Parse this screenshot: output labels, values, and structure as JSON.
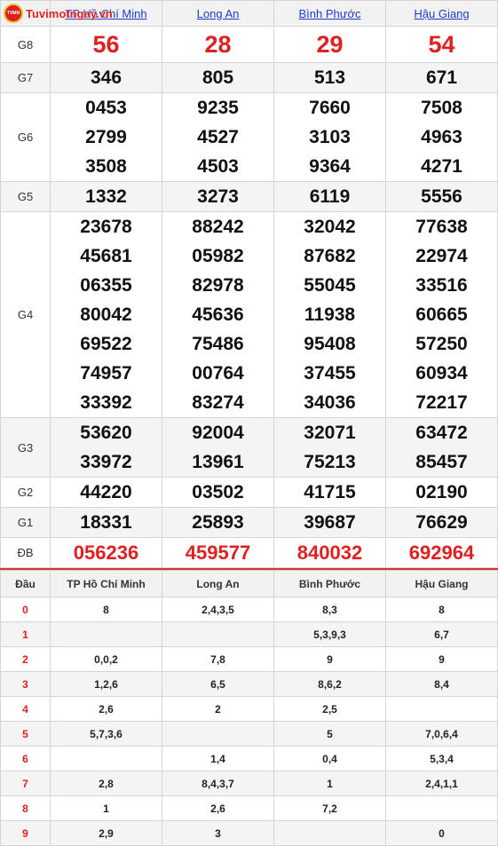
{
  "logo_text": "Tuvimotngay.vn",
  "provinces": [
    "TP Hồ Chí Minh",
    "Long An",
    "Bình Phước",
    "Hậu Giang"
  ],
  "prizes": [
    {
      "label": "G8",
      "values": [
        [
          "56"
        ],
        [
          "28"
        ],
        [
          "29"
        ],
        [
          "54"
        ]
      ]
    },
    {
      "label": "G7",
      "values": [
        [
          "346"
        ],
        [
          "805"
        ],
        [
          "513"
        ],
        [
          "671"
        ]
      ]
    },
    {
      "label": "G6",
      "values": [
        [
          "0453",
          "2799",
          "3508"
        ],
        [
          "9235",
          "4527",
          "4503"
        ],
        [
          "7660",
          "3103",
          "9364"
        ],
        [
          "7508",
          "4963",
          "4271"
        ]
      ]
    },
    {
      "label": "G5",
      "values": [
        [
          "1332"
        ],
        [
          "3273"
        ],
        [
          "6119"
        ],
        [
          "5556"
        ]
      ]
    },
    {
      "label": "G4",
      "values": [
        [
          "23678",
          "45681",
          "06355",
          "80042",
          "69522",
          "74957",
          "33392"
        ],
        [
          "88242",
          "05982",
          "82978",
          "45636",
          "75486",
          "00764",
          "83274"
        ],
        [
          "32042",
          "87682",
          "55045",
          "11938",
          "95408",
          "37455",
          "34036"
        ],
        [
          "77638",
          "22974",
          "33516",
          "60665",
          "57250",
          "60934",
          "72217"
        ]
      ]
    },
    {
      "label": "G3",
      "values": [
        [
          "53620",
          "33972"
        ],
        [
          "92004",
          "13961"
        ],
        [
          "32071",
          "75213"
        ],
        [
          "63472",
          "85457"
        ]
      ]
    },
    {
      "label": "G2",
      "values": [
        [
          "44220"
        ],
        [
          "03502"
        ],
        [
          "41715"
        ],
        [
          "02190"
        ]
      ]
    },
    {
      "label": "G1",
      "values": [
        [
          "18331"
        ],
        [
          "25893"
        ],
        [
          "39687"
        ],
        [
          "76629"
        ]
      ]
    },
    {
      "label": "ĐB",
      "values": [
        [
          "056236"
        ],
        [
          "459577"
        ],
        [
          "840032"
        ],
        [
          "692964"
        ]
      ]
    }
  ],
  "loto": {
    "headers": [
      "Đầu",
      "TP Hồ Chí Minh",
      "Long An",
      "Bình Phước",
      "Hậu Giang"
    ],
    "rows": [
      [
        "0",
        "8",
        "2,4,3,5",
        "8,3",
        "8"
      ],
      [
        "1",
        "",
        "",
        "5,3,9,3",
        "6,7"
      ],
      [
        "2",
        "0,0,2",
        "7,8",
        "9",
        "9"
      ],
      [
        "3",
        "1,2,6",
        "6,5",
        "8,6,2",
        "8,4"
      ],
      [
        "4",
        "2,6",
        "2",
        "2,5",
        ""
      ],
      [
        "5",
        "5,7,3,6",
        "",
        "5",
        "7,0,6,4"
      ],
      [
        "6",
        "",
        "1,4",
        "0,4",
        "5,3,4"
      ],
      [
        "7",
        "2,8",
        "8,4,3,7",
        "1",
        "2,4,1,1"
      ],
      [
        "8",
        "1",
        "2,6",
        "7,2",
        ""
      ],
      [
        "9",
        "2,9",
        "3",
        "",
        "0"
      ]
    ]
  }
}
